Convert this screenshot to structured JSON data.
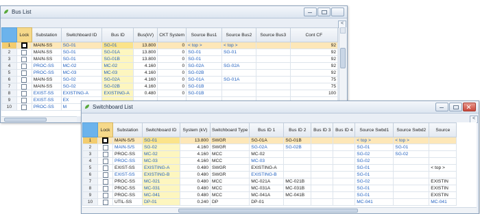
{
  "bus_window": {
    "title": "Bus List",
    "columns": [
      "Lock",
      "Substation",
      "Switchboard ID",
      "Bus ID",
      "Bus(kV)",
      "CKT System",
      "Source Bus1",
      "Source Bus2",
      "Source Bus3",
      "Cont CF"
    ],
    "rows": [
      {
        "n": "1",
        "sub": "MAIN-SS",
        "swbd": "SG-01",
        "bus": "SG-01",
        "kv": "13.800",
        "ckt": "0",
        "s1": "< top >",
        "s2": "< top >",
        "s3": "",
        "cf": "92"
      },
      {
        "n": "2",
        "sub": "MAIN-SS",
        "swbd": "SG-01",
        "bus": "SG-01A",
        "kv": "13.800",
        "ckt": "0",
        "s1": "SG-01",
        "s2": "SG-01",
        "s3": "",
        "cf": "92"
      },
      {
        "n": "3",
        "sub": "MAIN-SS",
        "swbd": "SG-01",
        "bus": "SG-01B",
        "kv": "13.800",
        "ckt": "0",
        "s1": "SG-01",
        "s2": "",
        "s3": "",
        "cf": "92"
      },
      {
        "n": "4",
        "sub": "PROC-SS",
        "swbd": "MC-02",
        "bus": "MC-02",
        "kv": "4.160",
        "ckt": "0",
        "s1": "SG-02A",
        "s2": "SG-02A",
        "s3": "",
        "cf": "92"
      },
      {
        "n": "5",
        "sub": "PROC-SS",
        "swbd": "MC-03",
        "bus": "MC-03",
        "kv": "4.160",
        "ckt": "0",
        "s1": "SG-02B",
        "s2": "",
        "s3": "",
        "cf": "92"
      },
      {
        "n": "6",
        "sub": "MAIN-SS",
        "swbd": "SG-02",
        "bus": "SG-02A",
        "kv": "4.160",
        "ckt": "0",
        "s1": "SG-01A",
        "s2": "SG-01A",
        "s3": "",
        "cf": "75"
      },
      {
        "n": "7",
        "sub": "MAIN-SS",
        "swbd": "SG-02",
        "bus": "SG-02B",
        "kv": "4.160",
        "ckt": "0",
        "s1": "SG-01B",
        "s2": "",
        "s3": "",
        "cf": "75"
      },
      {
        "n": "8",
        "sub": "EXIST-SS",
        "swbd": "EXISTING-A",
        "bus": "EXISTING-A",
        "kv": "0.480",
        "ckt": "0",
        "s1": "SG-01B",
        "s2": "",
        "s3": "",
        "cf": "100"
      },
      {
        "n": "9",
        "sub": "EXIST-SS",
        "swbd": "EX",
        "bus": "",
        "kv": "",
        "ckt": "",
        "s1": "",
        "s2": "",
        "s3": "",
        "cf": ""
      },
      {
        "n": "10",
        "sub": "PROC-SS",
        "swbd": "M",
        "bus": "",
        "kv": "",
        "ckt": "",
        "s1": "",
        "s2": "",
        "s3": "",
        "cf": ""
      }
    ]
  },
  "swbd_window": {
    "title": "Switchboard List",
    "columns": [
      "Lock",
      "Substation",
      "Switchboard ID",
      "System (kV)",
      "Switchboard Type",
      "Bus ID 1",
      "Bus ID 2",
      "Bus ID 3",
      "Bus ID 4",
      "Source Swbd1",
      "Source Swbd2",
      "Source"
    ],
    "rows": [
      {
        "n": "1",
        "sub": "MAIN-S/S",
        "id": "SG-01",
        "kv": "13.800",
        "type": "SWGR",
        "b1": "SG-01A",
        "b2": "SG-01B",
        "b3": "",
        "b4": "",
        "s1": "< top >",
        "s2": "< top >",
        "s3": ""
      },
      {
        "n": "2",
        "sub": "MAIN-S/S",
        "id": "SG-02",
        "kv": "4.160",
        "type": "SWGR",
        "b1": "SG-02A",
        "b2": "SG-02B",
        "b3": "",
        "b4": "",
        "s1": "SG-01",
        "s2": "SG-01",
        "s3": ""
      },
      {
        "n": "3",
        "sub": "PROC-SS",
        "id": "MC-02",
        "kv": "4.160",
        "type": "MCC",
        "b1": "MC-02",
        "b2": "",
        "b3": "",
        "b4": "",
        "s1": "SG-02",
        "s2": "SG-02",
        "s3": ""
      },
      {
        "n": "4",
        "sub": "PROC-SS",
        "id": "MC-03",
        "kv": "4.160",
        "type": "MCC",
        "b1": "MC-03",
        "b2": "",
        "b3": "",
        "b4": "",
        "s1": "SG-02",
        "s2": "",
        "s3": ""
      },
      {
        "n": "5",
        "sub": "EXIST-SS",
        "id": "EXISTING-A",
        "kv": "0.480",
        "type": "SWGR",
        "b1": "EXISTING-A",
        "b2": "",
        "b3": "",
        "b4": "",
        "s1": "SG-01",
        "s2": "",
        "s3": "< top >"
      },
      {
        "n": "6",
        "sub": "EXIST-SS",
        "id": "EXISTING-B",
        "kv": "0.480",
        "type": "SWGR",
        "b1": "EXISTING-B",
        "b2": "",
        "b3": "",
        "b4": "",
        "s1": "SG-01",
        "s2": "",
        "s3": ""
      },
      {
        "n": "7",
        "sub": "PROC-SS",
        "id": "MC-021",
        "kv": "0.480",
        "type": "MCC",
        "b1": "MC-021A",
        "b2": "MC-021B",
        "b3": "",
        "b4": "",
        "s1": "SG-02",
        "s2": "",
        "s3": "EXISTIN"
      },
      {
        "n": "8",
        "sub": "PROC-SS",
        "id": "MC-031",
        "kv": "0.480",
        "type": "MCC",
        "b1": "MC-031A",
        "b2": "MC-031B",
        "b3": "",
        "b4": "",
        "s1": "SG-01",
        "s2": "",
        "s3": "EXISTIN"
      },
      {
        "n": "9",
        "sub": "PROC-SS",
        "id": "MC-041",
        "kv": "0.480",
        "type": "MCC",
        "b1": "MC-041A",
        "b2": "MC-041B",
        "b3": "",
        "b4": "",
        "s1": "SG-01",
        "s2": "",
        "s3": "EXISTIN"
      },
      {
        "n": "10",
        "sub": "UTIL-SS",
        "id": "DP-01",
        "kv": "0.240",
        "type": "DP",
        "b1": "DP-01",
        "b2": "",
        "b3": "",
        "b4": "",
        "s1": "MC-041",
        "s2": "",
        "s3": "MC-041"
      }
    ]
  },
  "colors": {
    "accent": "#6cb3ec",
    "lock_header": "#f6d98a",
    "selected_row": "#fde7b8",
    "link_text": "#1f5fbf",
    "id_cell": "#fdf6bf"
  },
  "icons": {
    "app": "leaf-app-icon",
    "minimize": "minimize-icon",
    "maximize": "maximize-icon",
    "close": "close-icon"
  }
}
